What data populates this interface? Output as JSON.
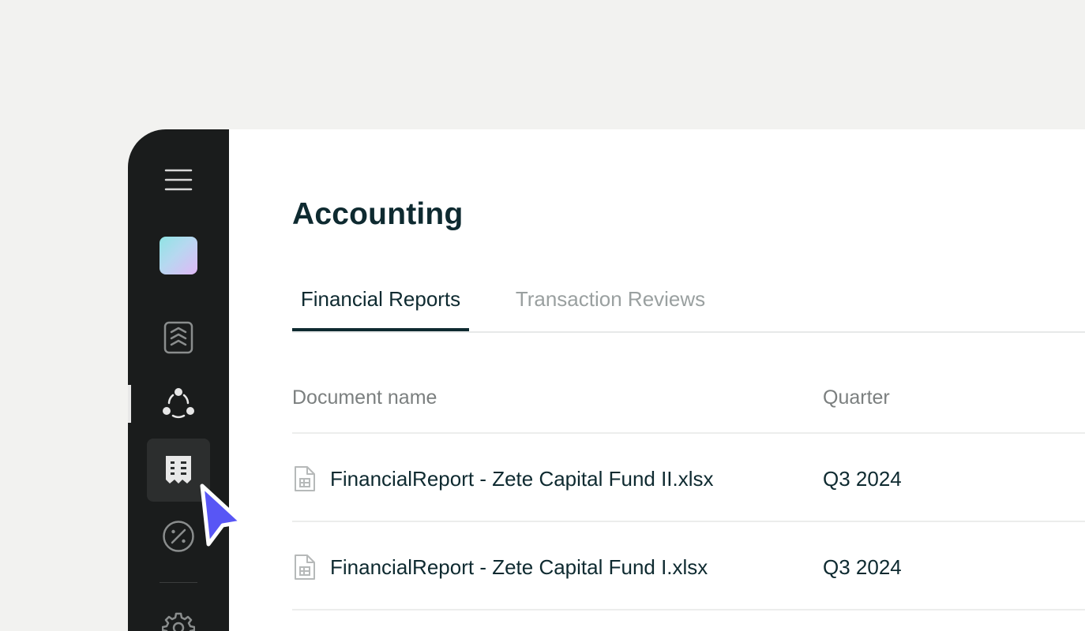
{
  "page": {
    "title": "Accounting"
  },
  "tabs": [
    {
      "label": "Financial Reports",
      "active": true
    },
    {
      "label": "Transaction Reviews",
      "active": false
    }
  ],
  "table": {
    "columns": [
      "Document name",
      "Quarter"
    ],
    "rows": [
      {
        "icon": "spreadsheet-file-icon",
        "name": "FinancialReport - Zete Capital Fund II.xlsx",
        "quarter": "Q3 2024"
      },
      {
        "icon": "spreadsheet-file-icon",
        "name": "FinancialReport - Zete Capital Fund I.xlsx",
        "quarter": "Q3 2024"
      }
    ]
  },
  "sidebar": {
    "items": [
      {
        "icon": "menu-icon"
      },
      {
        "icon": "workspace-avatar"
      },
      {
        "icon": "funds-icon"
      },
      {
        "icon": "network-icon"
      },
      {
        "icon": "receipt-icon",
        "selected": true
      },
      {
        "icon": "percent-icon"
      },
      {
        "icon": "gear-icon"
      }
    ]
  },
  "colors": {
    "sidebar_bg": "#1a1c1c",
    "text_primary": "#0e2a30",
    "cursor_accent": "#5856f5",
    "page_bg": "#f2f2f0"
  }
}
